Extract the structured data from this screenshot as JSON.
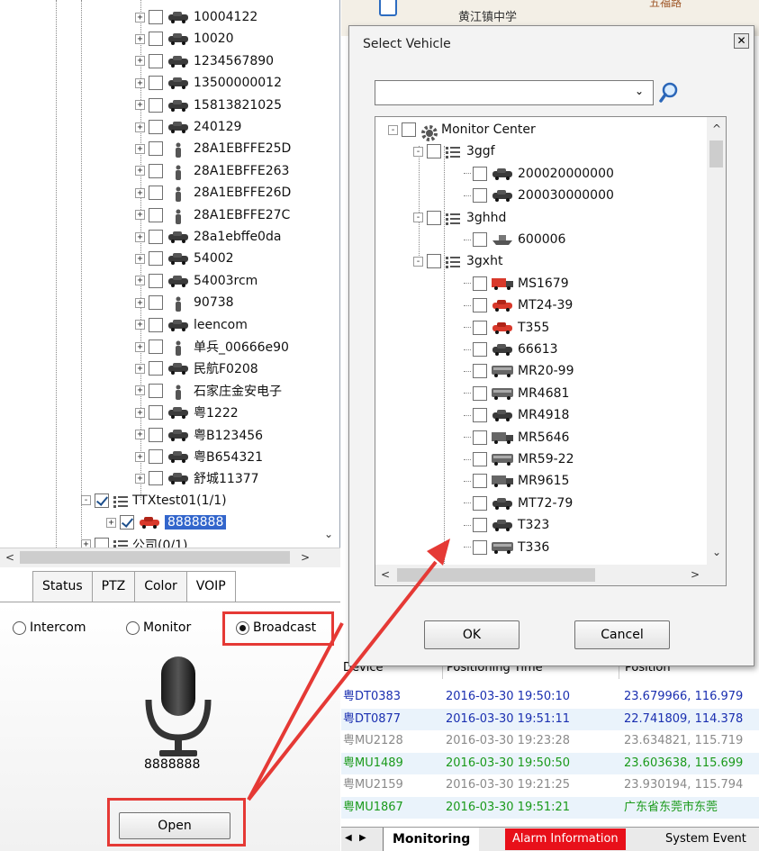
{
  "left_tree": {
    "items": [
      {
        "label": "10004122",
        "icon": "car-icon",
        "expand": "+"
      },
      {
        "label": "10020",
        "icon": "car-icon",
        "expand": "+"
      },
      {
        "label": "1234567890",
        "icon": "car-icon",
        "expand": "+"
      },
      {
        "label": "13500000012",
        "icon": "car-icon",
        "expand": "+"
      },
      {
        "label": "15813821025",
        "icon": "car-icon",
        "expand": "+"
      },
      {
        "label": "240129",
        "icon": "car-icon",
        "expand": "+"
      },
      {
        "label": "28A1EBFFE25D",
        "icon": "person-icon",
        "expand": "+"
      },
      {
        "label": "28A1EBFFE263",
        "icon": "person-icon",
        "expand": "+"
      },
      {
        "label": "28A1EBFFE26D",
        "icon": "person-icon",
        "expand": "+"
      },
      {
        "label": "28A1EBFFE27C",
        "icon": "person-icon",
        "expand": "+"
      },
      {
        "label": "28a1ebffe0da",
        "icon": "car-icon",
        "expand": "+"
      },
      {
        "label": "54002",
        "icon": "car-icon",
        "expand": "+"
      },
      {
        "label": "54003rcm",
        "icon": "car-icon",
        "expand": "+"
      },
      {
        "label": "90738",
        "icon": "person-icon",
        "expand": "+"
      },
      {
        "label": "leencom",
        "icon": "car-icon",
        "expand": "+"
      },
      {
        "label": "单兵_00666e90",
        "icon": "person-icon",
        "expand": "+"
      },
      {
        "label": "民航F0208",
        "icon": "car-icon",
        "expand": "+"
      },
      {
        "label": "石家庄金安电子",
        "icon": "person-icon",
        "expand": "+"
      },
      {
        "label": "粤1222",
        "icon": "car-icon",
        "expand": "+"
      },
      {
        "label": "粤B123456",
        "icon": "car-icon",
        "expand": "+"
      },
      {
        "label": "粤B654321",
        "icon": "car-icon",
        "expand": "+"
      },
      {
        "label": "舒城11377",
        "icon": "car-icon",
        "expand": "+"
      }
    ],
    "group": {
      "label": "TTXtest01(1/1)",
      "expand": "-",
      "checked": true
    },
    "selected_item": {
      "label": "8888888",
      "icon": "red-car-icon",
      "checked": true
    },
    "partial_item": {
      "label": "公司(0/1)"
    }
  },
  "tabs": [
    {
      "label": "Status",
      "active": false
    },
    {
      "label": "PTZ",
      "active": false
    },
    {
      "label": "Color",
      "active": false
    },
    {
      "label": "VOIP",
      "active": true
    }
  ],
  "voip": {
    "radios": [
      {
        "label": "Intercom",
        "selected": false
      },
      {
        "label": "Monitor",
        "selected": false
      },
      {
        "label": "Broadcast",
        "selected": true
      }
    ],
    "device_label": "8888888",
    "open_button": "Open"
  },
  "map": {
    "school_label": "黄江镇中学",
    "top_label": "五福路"
  },
  "dialog": {
    "title": "Select Vehicle",
    "close_glyph": "✕",
    "search_value": "",
    "tree": [
      {
        "label": "Monitor Center",
        "level": 0,
        "icon": "gear-icon",
        "expand": "-"
      },
      {
        "label": "3ggf",
        "level": 1,
        "icon": "list-icon",
        "expand": "-"
      },
      {
        "label": "200020000000",
        "level": 2,
        "icon": "car-icon"
      },
      {
        "label": "200030000000",
        "level": 2,
        "icon": "car-icon"
      },
      {
        "label": "3ghhd",
        "level": 1,
        "icon": "list-icon",
        "expand": "-"
      },
      {
        "label": "600006",
        "level": 2,
        "icon": "ship-icon"
      },
      {
        "label": "3gxht",
        "level": 1,
        "icon": "list-icon",
        "expand": "-"
      },
      {
        "label": "MS1679",
        "level": 2,
        "icon": "red-truck-icon"
      },
      {
        "label": "MT24-39",
        "level": 2,
        "icon": "red-car-icon"
      },
      {
        "label": "T355",
        "level": 2,
        "icon": "red-car-icon"
      },
      {
        "label": "66613",
        "level": 2,
        "icon": "car-icon"
      },
      {
        "label": "MR20-99",
        "level": 2,
        "icon": "bus-icon"
      },
      {
        "label": "MR4681",
        "level": 2,
        "icon": "bus-icon"
      },
      {
        "label": "MR4918",
        "level": 2,
        "icon": "car-icon"
      },
      {
        "label": "MR5646",
        "level": 2,
        "icon": "truck-icon"
      },
      {
        "label": "MR59-22",
        "level": 2,
        "icon": "bus-icon"
      },
      {
        "label": "MR9615",
        "level": 2,
        "icon": "truck-icon"
      },
      {
        "label": "MT72-79",
        "level": 2,
        "icon": "car-icon"
      },
      {
        "label": "T323",
        "level": 2,
        "icon": "car-icon"
      },
      {
        "label": "T336",
        "level": 2,
        "icon": "bus-icon"
      }
    ],
    "ok_button": "OK",
    "cancel_button": "Cancel"
  },
  "grid": {
    "columns": [
      "Device",
      "Positioning Time",
      "Position"
    ],
    "rows": [
      {
        "device": "粤DT0383",
        "time": "2016-03-30 19:50:10",
        "position": "23.679966, 116.979",
        "color": "#1a2fb0"
      },
      {
        "device": "粤DT0877",
        "time": "2016-03-30 19:51:11",
        "position": "22.741809, 114.378",
        "color": "#1a2fb0"
      },
      {
        "device": "粤MU2128",
        "time": "2016-03-30 19:23:28",
        "position": "23.634821, 115.719",
        "color": "#8a8a8a"
      },
      {
        "device": "粤MU1489",
        "time": "2016-03-30 19:50:50",
        "position": "23.603638, 115.699",
        "color": "#1a9a1a"
      },
      {
        "device": "粤MU2159",
        "time": "2016-03-30 19:21:25",
        "position": "23.930194, 115.794",
        "color": "#8a8a8a"
      },
      {
        "device": "粤MU1867",
        "time": "2016-03-30 19:51:21",
        "position": "广东省东莞市东莞",
        "color": "#1a9a1a"
      }
    ]
  },
  "bottom_tabs": [
    {
      "label": "Monitoring",
      "style": "active"
    },
    {
      "label": "Alarm Information",
      "style": "alarm"
    },
    {
      "label": "System Event",
      "style": "normal"
    }
  ],
  "colors": {
    "annotation_red": "#e53935",
    "selection_blue": "#3366cc"
  }
}
